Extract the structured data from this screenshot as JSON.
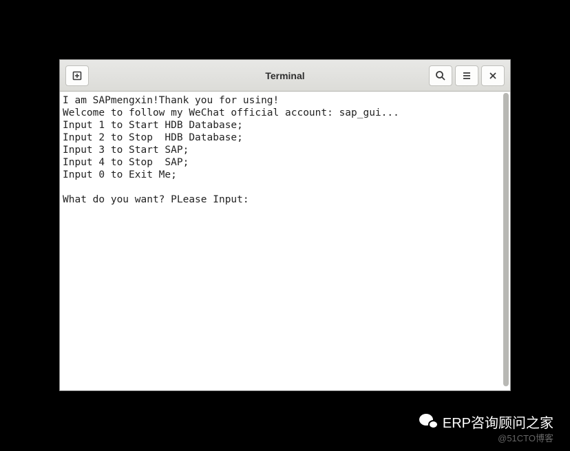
{
  "window": {
    "title": "Terminal"
  },
  "terminal": {
    "lines": [
      "I am SAPmengxin!Thank you for using!",
      "Welcome to follow my WeChat official account: sap_gui...",
      "Input 1 to Start HDB Database;",
      "Input 2 to Stop  HDB Database;",
      "Input 3 to Start SAP;",
      "Input 4 to Stop  SAP;",
      "Input 0 to Exit Me;",
      "",
      "What do you want? PLease Input:"
    ]
  },
  "watermark": {
    "text1": "ERP咨询顾问之家",
    "text2": "@51CTO博客"
  }
}
